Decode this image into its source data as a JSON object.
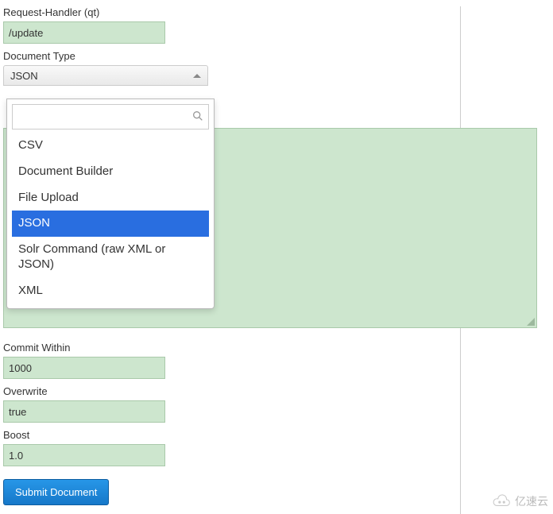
{
  "fields": {
    "request_handler": {
      "label": "Request-Handler (qt)",
      "value": "/update"
    },
    "document_type": {
      "label": "Document Type",
      "selected": "JSON",
      "options": [
        "CSV",
        "Document Builder",
        "File Upload",
        "JSON",
        "Solr Command (raw XML or JSON)",
        "XML"
      ],
      "search_placeholder": ""
    },
    "commit_within": {
      "label": "Commit Within",
      "value": "1000"
    },
    "overwrite": {
      "label": "Overwrite",
      "value": "true"
    },
    "boost": {
      "label": "Boost",
      "value": "1.0"
    }
  },
  "submit_label": "Submit Document",
  "watermark_text": "亿速云"
}
